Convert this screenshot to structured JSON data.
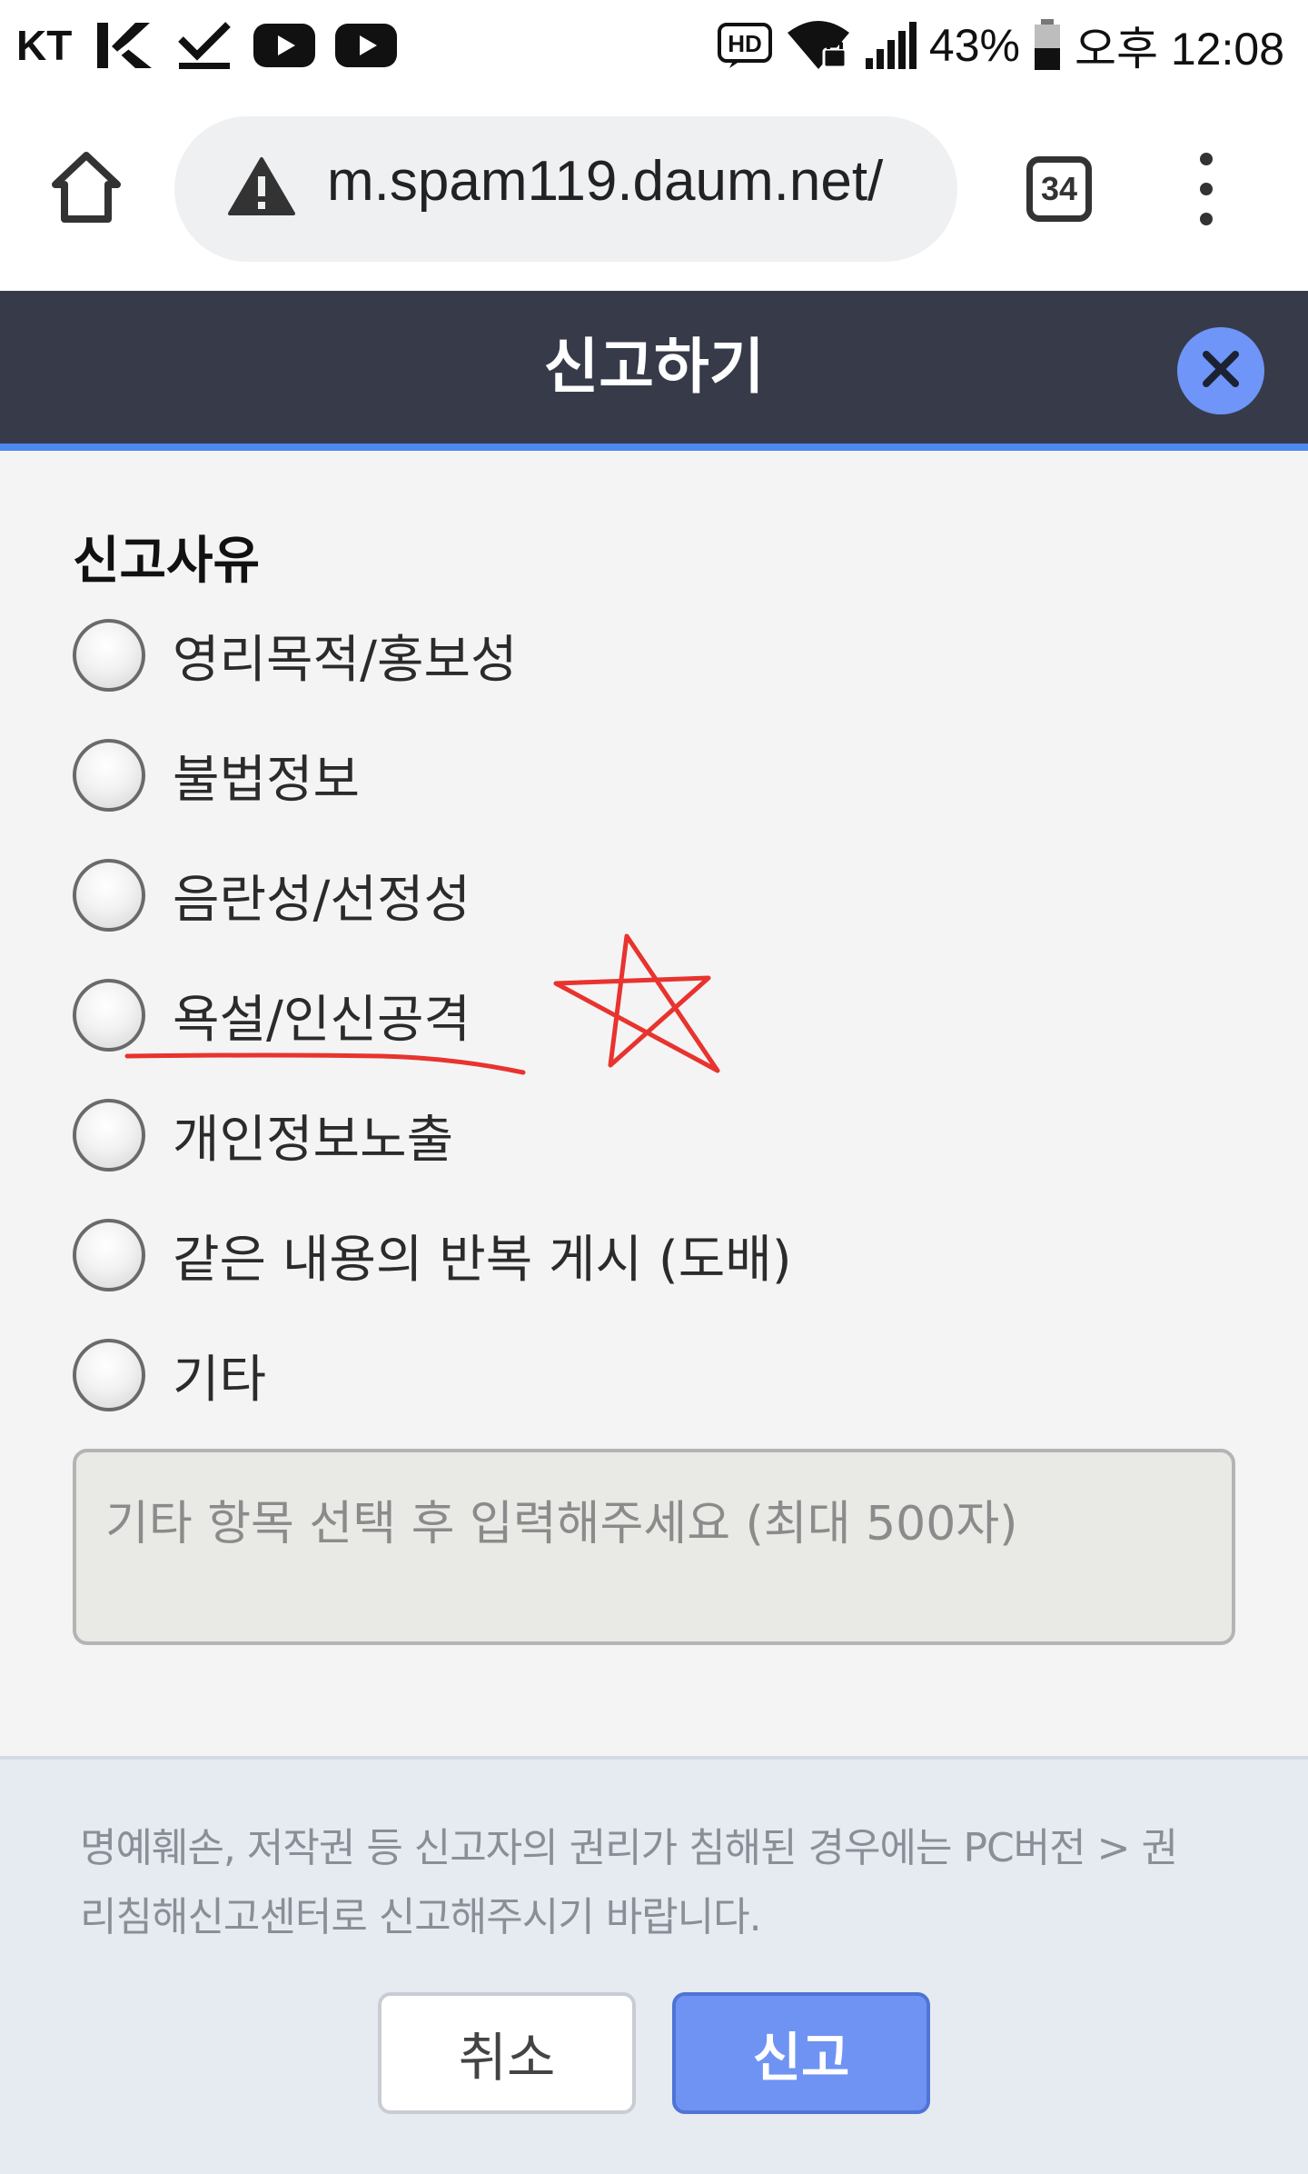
{
  "status_bar": {
    "carrier": "KT",
    "battery": "43%",
    "time": "오후 12:08",
    "hd_label": "HD",
    "icons": [
      "kt-app-icon",
      "download-done-icon",
      "youtube-icon",
      "youtube-icon",
      "hd-voice-icon",
      "wifi-lock-icon",
      "signal-icon",
      "battery-icon"
    ]
  },
  "browser": {
    "url": "m.spam119.daum.net/",
    "tab_count": "34",
    "icons": [
      "home-icon",
      "warning-icon",
      "more-vert-icon"
    ]
  },
  "modal": {
    "title": "신고하기",
    "reason_heading": "신고사유",
    "options": [
      {
        "label": "영리목적/홍보성"
      },
      {
        "label": "불법정보"
      },
      {
        "label": "음란성/선정성"
      },
      {
        "label": "욕설/인신공격"
      },
      {
        "label": "개인정보노출"
      },
      {
        "label": "같은 내용의 반복 게시 (도배)"
      },
      {
        "label": "기타"
      }
    ],
    "textarea_placeholder": "기타 항목 선택 후 입력해주세요 (최대 500자)",
    "notice_line1": "명예훼손, 저작권 등 신고자의 권리가 침해된 경우에는 PC버전 > 권",
    "notice_line2": "리침해신고센터로 신고해주시기 바랍니다.",
    "cancel_label": "취소",
    "submit_label": "신고"
  },
  "colors": {
    "header_bg": "#373b49",
    "header_accent": "#4c8af0",
    "close_button": "#6e95f7",
    "submit_button": "#6f93f3",
    "annotation": "#e8332e"
  }
}
